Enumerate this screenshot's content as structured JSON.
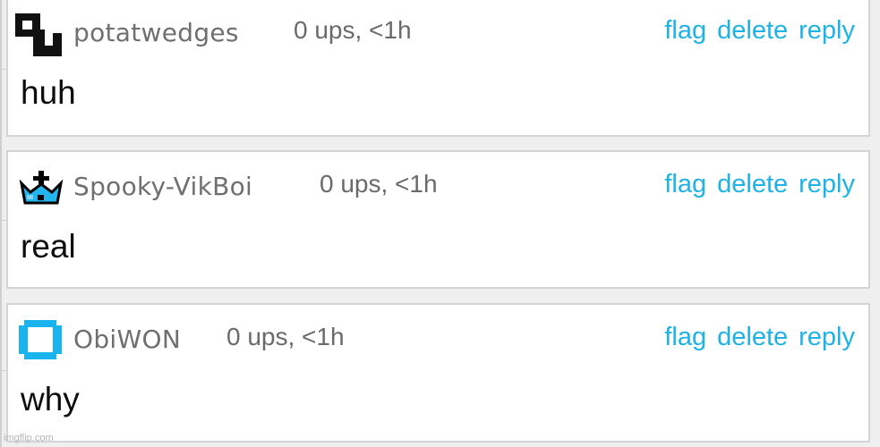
{
  "comments": [
    {
      "author": "potatwedges",
      "meta": "0 ups, <1h",
      "actions": {
        "flag": "flag",
        "delete": "delete",
        "reply": "reply"
      },
      "body": "huh",
      "avatar_icon": "black-pixel-blocks-icon"
    },
    {
      "author": "Spooky-VikBoi",
      "meta": "0 ups, <1h",
      "actions": {
        "flag": "flag",
        "delete": "delete",
        "reply": "reply"
      },
      "body": "real",
      "avatar_icon": "blue-crown-icon"
    },
    {
      "author": "ObiWON",
      "meta": "0 ups, <1h",
      "actions": {
        "flag": "flag",
        "delete": "delete",
        "reply": "reply"
      },
      "body": "why",
      "avatar_icon": "blue-square-outline-icon"
    }
  ],
  "watermark": "imgflip.com",
  "colors": {
    "action_link": "#1fb2e5",
    "username": "#6f6f6f",
    "avatar_blue": "#19b3ee",
    "page_bg": "#efefef",
    "card_border": "#d4d4d4"
  }
}
